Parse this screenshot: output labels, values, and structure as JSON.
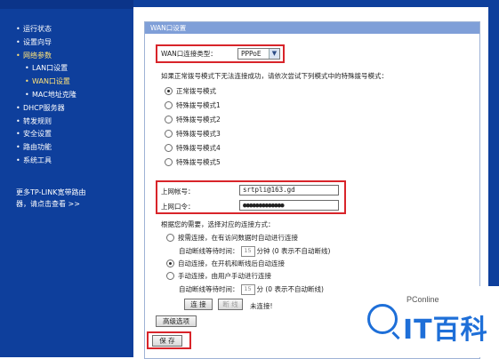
{
  "sidebar": {
    "items": [
      {
        "label": "运行状态",
        "sub": false,
        "active": false
      },
      {
        "label": "设置向导",
        "sub": false,
        "active": false
      },
      {
        "label": "网络参数",
        "sub": false,
        "active": true
      },
      {
        "label": "LAN口设置",
        "sub": true,
        "active": false
      },
      {
        "label": "WAN口设置",
        "sub": true,
        "active": true
      },
      {
        "label": "MAC地址克隆",
        "sub": true,
        "active": false
      },
      {
        "label": "DHCP服务器",
        "sub": false,
        "active": false
      },
      {
        "label": "转发规则",
        "sub": false,
        "active": false
      },
      {
        "label": "安全设置",
        "sub": false,
        "active": false
      },
      {
        "label": "路由功能",
        "sub": false,
        "active": false
      },
      {
        "label": "系统工具",
        "sub": false,
        "active": false
      }
    ],
    "bullet": "•",
    "more_line1": "更多TP-LINK宽带路由",
    "more_line2": "器，请点击查看 >>"
  },
  "panel": {
    "title": "WAN口设置",
    "wan_type_label": "WAN口连接类型：",
    "wan_type_value": "PPPoE",
    "special_dial_hint": "如果正常拨号模式下无法连接成功，请依次尝试下列模式中的特殊拨号模式：",
    "dial_modes": [
      {
        "label": "正常拨号模式",
        "selected": true
      },
      {
        "label": "特殊拨号模式1",
        "selected": false
      },
      {
        "label": "特殊拨号模式2",
        "selected": false
      },
      {
        "label": "特殊拨号模式3",
        "selected": false
      },
      {
        "label": "特殊拨号模式4",
        "selected": false
      },
      {
        "label": "特殊拨号模式5",
        "selected": false
      }
    ],
    "account_label": "上网帐号：",
    "account_value": "srtpli@163.gd",
    "password_label": "上网口令：",
    "password_value": "●●●●●●●●●●●●●",
    "conn_mode_hint": "根据您的需要，选择对应的连接方式：",
    "on_demand_label": "按需连接，在有访问数据时自动进行连接",
    "idle_label_1": "自动断线等待时间：",
    "idle_value_1": "15",
    "idle_unit_1": "分钟 (0 表示不自动断线)",
    "auto_label": "自动连接，在开机和断线后自动连接",
    "manual_label": "手动连接，由用户手动进行连接",
    "idle_label_2": "自动断线等待时间：",
    "idle_value_2": "15",
    "idle_unit_2": "分 (0 表示不自动断线)",
    "connect_button": "连 接",
    "disconnect_button": "断 线",
    "status_text": "未连接!",
    "advanced_button": "高级选项",
    "save_button": "保 存"
  },
  "logo": {
    "brand": "PConline",
    "cn": "IT百科"
  },
  "colors": {
    "sidebar_bg": "#0e3f9c",
    "highlight_red": "#d8242a",
    "panel_header": "#7f9fd8",
    "logo_blue": "#1e6fd8"
  }
}
